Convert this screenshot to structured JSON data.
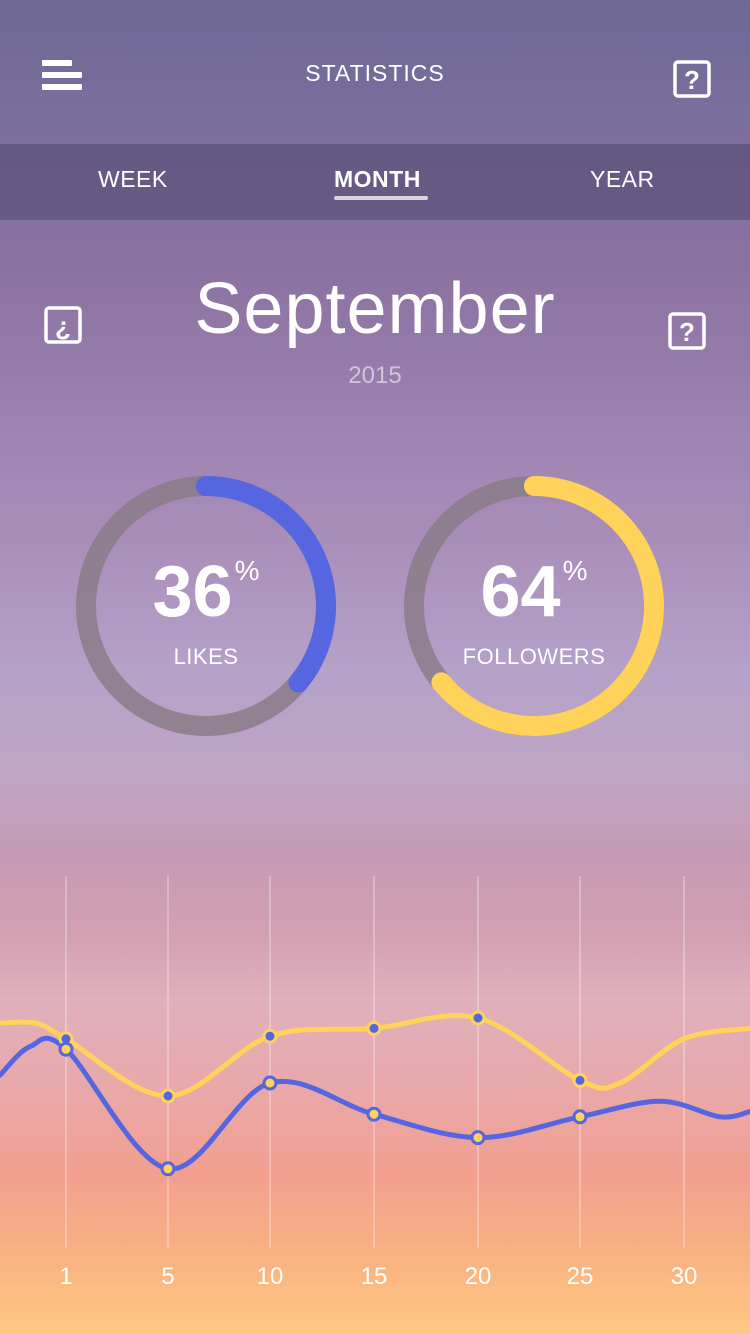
{
  "header": {
    "title": "STATISTICS",
    "menu_icon": "hamburger-icon",
    "help_icon": "help-icon"
  },
  "tabs": [
    {
      "label": "WEEK",
      "active": false
    },
    {
      "label": "MONTH",
      "active": true
    },
    {
      "label": "YEAR",
      "active": false
    }
  ],
  "period": {
    "month": "September",
    "year": "2015",
    "info_icon": "info-icon",
    "help_icon": "help-icon"
  },
  "stats": [
    {
      "value": "36",
      "unit": "%",
      "label": "LIKES",
      "percent": 36,
      "color": "#5566e0"
    },
    {
      "value": "64",
      "unit": "%",
      "label": "FOLLOWERS",
      "percent": 64,
      "color": "#ffd35a"
    }
  ],
  "colors": {
    "likes": "#5566e0",
    "followers": "#ffd35a",
    "track": "#8a7c88"
  },
  "chart_data": {
    "type": "line",
    "x_ticks": [
      "1",
      "5",
      "10",
      "15",
      "20",
      "25",
      "30"
    ],
    "series": [
      {
        "color": "#ffd35a",
        "points": [
          [
            1,
            0.62
          ],
          [
            5,
            0.4
          ],
          [
            10,
            0.63
          ],
          [
            15,
            0.66
          ],
          [
            20,
            0.7
          ],
          [
            25,
            0.46
          ]
        ]
      },
      {
        "color": "#5566e0",
        "points": [
          [
            1,
            0.58
          ],
          [
            5,
            0.12
          ],
          [
            10,
            0.45
          ],
          [
            15,
            0.33
          ],
          [
            20,
            0.24
          ],
          [
            25,
            0.32
          ]
        ]
      }
    ]
  }
}
